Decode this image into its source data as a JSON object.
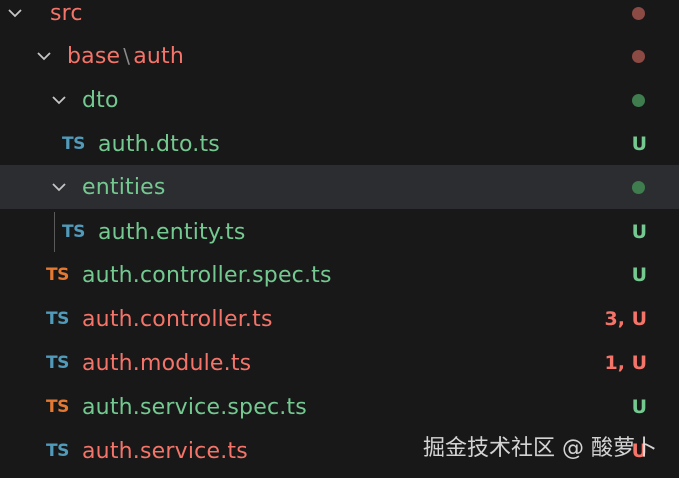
{
  "colors": {
    "background": "#181818",
    "selected_row": "#2b2d31",
    "git_modified": "#f47469",
    "git_untracked": "#74c991",
    "ts_icon_blue": "#519aba",
    "ts_icon_orange": "#e37933"
  },
  "tree": {
    "rows": [
      {
        "type": "folder",
        "label": "src",
        "status_dot": "red"
      },
      {
        "type": "folder",
        "label_parts": [
          "base",
          "\\",
          "auth"
        ],
        "status_dot": "red"
      },
      {
        "type": "folder",
        "label": "dto",
        "status_dot": "green"
      },
      {
        "type": "file",
        "icon": "TS",
        "label": "auth.dto.ts",
        "status": "U"
      },
      {
        "type": "folder",
        "label": "entities",
        "status_dot": "green",
        "selected": true
      },
      {
        "type": "file",
        "icon": "TS",
        "label": "auth.entity.ts",
        "status": "U"
      },
      {
        "type": "file",
        "icon": "TS",
        "label": "auth.controller.spec.ts",
        "status": "U"
      },
      {
        "type": "file",
        "icon": "TS",
        "label": "auth.controller.ts",
        "status": "3, U"
      },
      {
        "type": "file",
        "icon": "TS",
        "label": "auth.module.ts",
        "status": "1, U"
      },
      {
        "type": "file",
        "icon": "TS",
        "label": "auth.service.spec.ts",
        "status": "U"
      },
      {
        "type": "file",
        "icon": "TS",
        "label": "auth.service.ts",
        "status": "U"
      }
    ]
  },
  "watermark": "掘金技术社区 @ 酸萝卜"
}
